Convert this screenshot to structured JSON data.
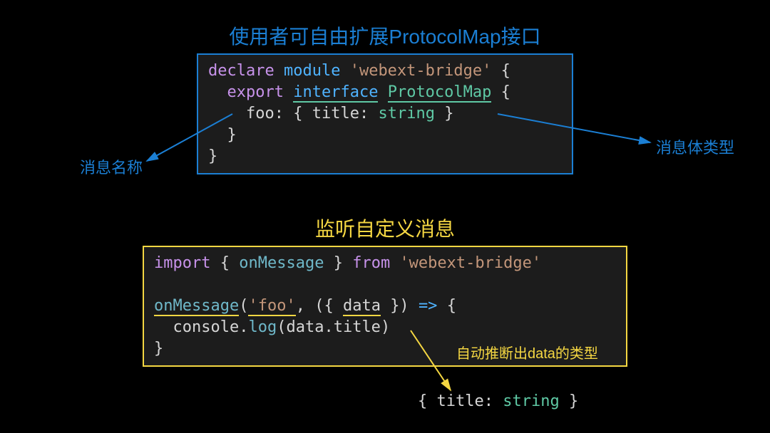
{
  "title1": "使用者可自由扩展ProtocolMap接口",
  "title2": "监听自定义消息",
  "label_left": "消息名称",
  "label_right": "消息体类型",
  "label_infer": "自动推断出data的类型",
  "code1": {
    "l1_declare": "declare",
    "l1_module": "module",
    "l1_str": "'webext-bridge'",
    "l1_brace": "{",
    "l2_export": "export",
    "l2_interface": "interface",
    "l2_name": "ProtocolMap",
    "l2_brace": "{",
    "l3_key": "foo",
    "l3_colon": ":",
    "l3_obrace": "{",
    "l3_prop": "title",
    "l3_pcolon": ":",
    "l3_type": "string",
    "l3_cbrace": "}",
    "l4_cbrace": "}",
    "l5_cbrace": "}"
  },
  "code2": {
    "l1_import": "import",
    "l1_ob": "{",
    "l1_name": "onMessage",
    "l1_cb": "}",
    "l1_from": "from",
    "l1_pkg": "'webext-bridge'",
    "l3_fn": "onMessage",
    "l3_op": "(",
    "l3_arg": "'foo'",
    "l3_comma": ",",
    "l3_destr_o": "({",
    "l3_destr_d": "data",
    "l3_destr_c": "})",
    "l3_arrow": "=>",
    "l3_brace": "{",
    "l4_console": "console",
    "l4_dot": ".",
    "l4_log": "log",
    "l4_op": "(",
    "l4_obj": "data",
    "l4_dot2": ".",
    "l4_prop": "title",
    "l4_cp": ")",
    "l5_brace": "}"
  },
  "code3": {
    "ob": "{",
    "prop": "title",
    "colon": ":",
    "type": "string",
    "cb": "}"
  }
}
